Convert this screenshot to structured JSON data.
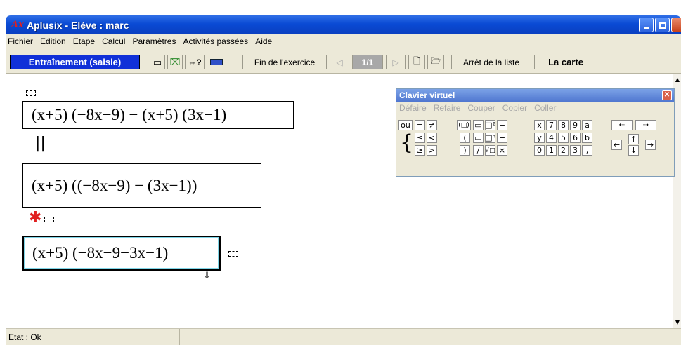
{
  "window": {
    "title": "Aplusix - Elève : marc",
    "app_icon": "Ax"
  },
  "menubar": {
    "items": [
      "Fichier",
      "Edition",
      "Etape",
      "Calcul",
      "Paramètres",
      "Activités passées",
      "Aide"
    ]
  },
  "toolbar": {
    "mode_label": "Entraînement (saisie)",
    "end_exercise_label": "Fin de l'exercice",
    "page_indicator": "1/1",
    "stop_list_label": "Arrêt de la liste",
    "map_label": "La carte",
    "equiv_question": "⇔?"
  },
  "workspace": {
    "expr1": "(x+5) (−8x−9) − (x+5) (3x−1)",
    "expr2": "(x+5) ((−8x−9) − (3x−1))",
    "expr3": "(x+5) (−8x−9−3x−1)",
    "equiv_symbol": "||",
    "not_equiv_symbol": "✱"
  },
  "keyboard": {
    "title": "Clavier virtuel",
    "menu": [
      "Défaire",
      "Refaire",
      "Couper",
      "Copier",
      "Coller"
    ],
    "keys_row1": [
      "ou",
      "=",
      "≠",
      "(□)",
      "▭",
      "□²",
      "+",
      "x",
      "7",
      "8",
      "9",
      "a"
    ],
    "keys_row2": [
      "≤",
      "<",
      "(",
      "▭",
      "□ⁿ",
      "−",
      "y",
      "4",
      "5",
      "6",
      "b"
    ],
    "keys_row3": [
      "≥",
      ">",
      ")",
      "/",
      "√□",
      "×",
      "0",
      "1",
      "2",
      "3",
      ","
    ]
  },
  "status": {
    "text": "Etat : Ok"
  },
  "colors": {
    "title_blue": "#0a4ad4",
    "mode_blue": "#1030d8",
    "not_equiv_red": "#e02020",
    "selection_cyan": "#7fd6e8"
  }
}
